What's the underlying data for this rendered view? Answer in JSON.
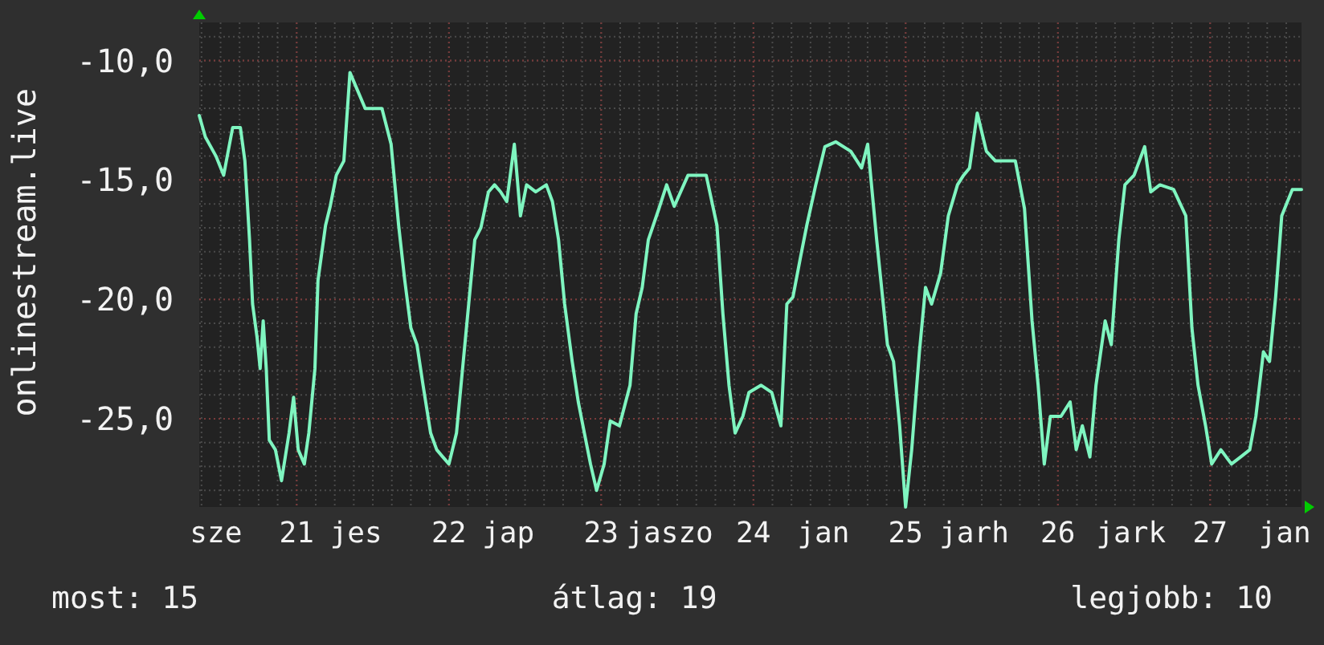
{
  "graph": {
    "chart_data": {
      "type": "line",
      "grid": true,
      "xlim": [
        20.36,
        27.6
      ],
      "ylim": [
        -28.7,
        -8.4
      ],
      "yticks": [
        {
          "value": -10,
          "label": "-10,0"
        },
        {
          "value": -15,
          "label": "-15,0"
        },
        {
          "value": -20,
          "label": "-20,0"
        },
        {
          "value": -25,
          "label": "-25,0"
        }
      ],
      "xticks": [
        {
          "value": 20.47,
          "label": "sze"
        },
        {
          "value": 21.0,
          "label": "21"
        },
        {
          "value": 21.39,
          "label": "jes"
        },
        {
          "value": 22.0,
          "label": "22"
        },
        {
          "value": 22.39,
          "label": "jap"
        },
        {
          "value": 23.0,
          "label": "23"
        },
        {
          "value": 23.45,
          "label": "jaszo"
        },
        {
          "value": 24.0,
          "label": "24"
        },
        {
          "value": 24.46,
          "label": "jan"
        },
        {
          "value": 25.0,
          "label": "25"
        },
        {
          "value": 25.45,
          "label": "jarh"
        },
        {
          "value": 26.0,
          "label": "26"
        },
        {
          "value": 26.48,
          "label": "jark"
        },
        {
          "value": 27.0,
          "label": "27"
        },
        {
          "value": 27.49,
          "label": "jan"
        }
      ],
      "x": [
        20.36,
        20.4,
        20.47,
        20.52,
        20.58,
        20.63,
        20.66,
        20.69,
        20.71,
        20.74,
        20.76,
        20.78,
        20.8,
        20.82,
        20.86,
        20.9,
        20.95,
        20.98,
        21.01,
        21.05,
        21.08,
        21.12,
        21.14,
        21.19,
        21.22,
        21.26,
        21.31,
        21.35,
        21.39,
        21.45,
        21.56,
        21.62,
        21.67,
        21.71,
        21.75,
        21.79,
        21.83,
        21.88,
        21.92,
        21.96,
        22.0,
        22.05,
        22.09,
        22.13,
        22.17,
        22.21,
        22.26,
        22.3,
        22.34,
        22.38,
        22.43,
        22.47,
        22.51,
        22.57,
        22.64,
        22.68,
        22.72,
        22.76,
        22.81,
        22.85,
        22.89,
        22.93,
        22.97,
        23.02,
        23.06,
        23.12,
        23.19,
        23.23,
        23.27,
        23.31,
        23.38,
        23.43,
        23.48,
        23.57,
        23.69,
        23.76,
        23.8,
        23.84,
        23.88,
        23.93,
        23.97,
        24.05,
        24.12,
        24.18,
        24.22,
        24.26,
        24.31,
        24.35,
        24.41,
        24.47,
        24.54,
        24.64,
        24.71,
        24.75,
        24.81,
        24.88,
        24.92,
        24.96,
        25.0,
        25.04,
        25.09,
        25.13,
        25.17,
        25.23,
        25.28,
        25.34,
        25.38,
        25.42,
        25.47,
        25.53,
        25.59,
        25.72,
        25.78,
        25.83,
        25.87,
        25.91,
        25.95,
        26.02,
        26.08,
        26.12,
        26.16,
        26.21,
        26.25,
        26.31,
        26.35,
        26.4,
        26.44,
        26.5,
        26.57,
        26.61,
        26.67,
        26.76,
        26.84,
        26.88,
        26.92,
        26.97,
        27.01,
        27.07,
        27.14,
        27.2,
        27.26,
        27.3,
        27.35,
        27.39,
        27.43,
        27.47,
        27.54,
        27.6
      ],
      "series": [
        {
          "name": "onlinestream.live",
          "color": "#7ff5c0",
          "values": [
            -12.3,
            -13.2,
            -14.0,
            -14.8,
            -12.8,
            -12.8,
            -14.2,
            -17.5,
            -20.2,
            -21.6,
            -22.9,
            -20.9,
            -22.9,
            -25.9,
            -26.3,
            -27.6,
            -25.6,
            -24.1,
            -26.3,
            -26.9,
            -25.6,
            -22.9,
            -19.2,
            -16.9,
            -16.1,
            -14.8,
            -14.2,
            -10.5,
            -11.1,
            -12.0,
            -12.0,
            -13.5,
            -16.9,
            -19.2,
            -21.2,
            -21.9,
            -23.6,
            -25.6,
            -26.3,
            -26.6,
            -26.9,
            -25.6,
            -22.9,
            -20.2,
            -17.5,
            -17.0,
            -15.5,
            -15.2,
            -15.5,
            -15.9,
            -13.5,
            -16.5,
            -15.2,
            -15.5,
            -15.2,
            -15.9,
            -17.5,
            -20.2,
            -22.6,
            -24.3,
            -25.6,
            -26.9,
            -28.0,
            -26.9,
            -25.1,
            -25.3,
            -23.6,
            -20.6,
            -19.5,
            -17.5,
            -16.2,
            -15.2,
            -16.1,
            -14.8,
            -14.8,
            -16.9,
            -20.6,
            -23.6,
            -25.6,
            -24.9,
            -23.9,
            -23.6,
            -23.9,
            -25.3,
            -20.2,
            -19.9,
            -18.2,
            -16.9,
            -15.2,
            -13.6,
            -13.4,
            -13.8,
            -14.5,
            -13.5,
            -17.5,
            -21.9,
            -22.6,
            -25.3,
            -28.7,
            -26.3,
            -22.2,
            -19.5,
            -20.2,
            -18.9,
            -16.5,
            -15.2,
            -14.8,
            -14.5,
            -12.2,
            -13.8,
            -14.2,
            -14.2,
            -16.2,
            -20.9,
            -23.6,
            -26.9,
            -24.9,
            -24.9,
            -24.3,
            -26.3,
            -25.3,
            -26.6,
            -23.6,
            -20.9,
            -21.9,
            -17.5,
            -15.2,
            -14.8,
            -13.6,
            -15.5,
            -15.2,
            -15.4,
            -16.5,
            -21.2,
            -23.6,
            -25.3,
            -26.9,
            -26.3,
            -26.9,
            -26.6,
            -26.3,
            -24.9,
            -22.2,
            -22.6,
            -19.9,
            -16.5,
            -15.4,
            -15.4
          ]
        }
      ]
    }
  },
  "footer": [
    {
      "label": "most:",
      "value": "15"
    },
    {
      "label": "átlag:",
      "value": "19"
    },
    {
      "label": "legjobb:",
      "value": "10"
    }
  ]
}
